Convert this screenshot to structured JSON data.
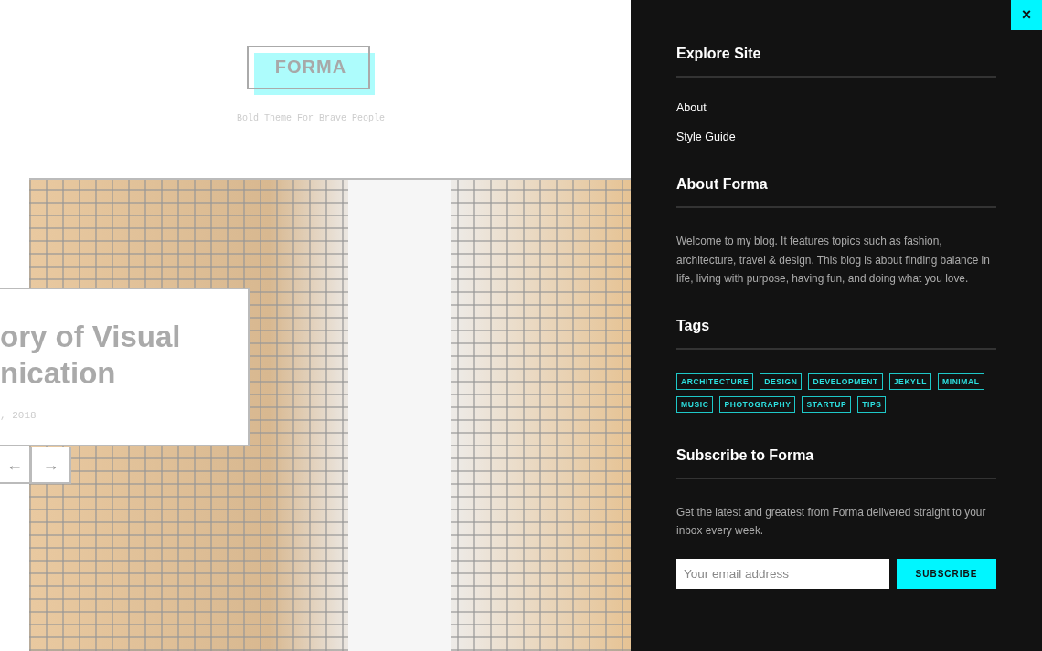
{
  "site": {
    "logo": "FORMA",
    "tagline": "Bold Theme For Brave People"
  },
  "featured_post": {
    "title_lines": [
      "ory of Visual",
      "nication"
    ],
    "date": ", 2018"
  },
  "slider_controls": {
    "previous": "←",
    "next": "→"
  },
  "sidebar": {
    "close": "×",
    "explore": {
      "heading": "Explore Site",
      "links": [
        "About",
        "Style Guide"
      ]
    },
    "about": {
      "heading": "About Forma",
      "text": "Welcome to my blog. It features topics such as fashion, architecture, travel & design. This blog is about finding balance in life, living with purpose, having fun, and doing what you love."
    },
    "tags": {
      "heading": "Tags",
      "items": [
        "ARCHITECTURE",
        "DESIGN",
        "DEVELOPMENT",
        "JEKYLL",
        "MINIMAL",
        "MUSIC",
        "PHOTOGRAPHY",
        "STARTUP",
        "TIPS"
      ]
    },
    "subscribe": {
      "heading": "Subscribe to Forma",
      "text": "Get the latest and greatest from Forma delivered straight to your inbox every week.",
      "placeholder": "Your email address",
      "button": "SUBSCRIBE"
    }
  }
}
